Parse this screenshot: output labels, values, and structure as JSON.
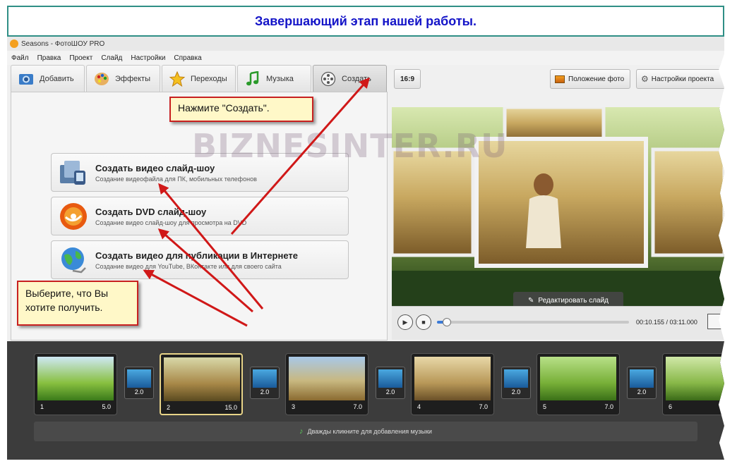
{
  "banner": {
    "text": "Завершающий этап нашей работы."
  },
  "app": {
    "title": "Seasons - ФотоШОУ PRO"
  },
  "menu": [
    "Файл",
    "Правка",
    "Проект",
    "Слайд",
    "Настройки",
    "Справка"
  ],
  "tabs": [
    {
      "label": "Добавить",
      "icon": "add-photo-icon"
    },
    {
      "label": "Эффекты",
      "icon": "palette-icon"
    },
    {
      "label": "Переходы",
      "icon": "star-icon"
    },
    {
      "label": "Музыка",
      "icon": "music-note-icon"
    },
    {
      "label": "Создать",
      "icon": "film-reel-icon"
    }
  ],
  "options": [
    {
      "title": "Создать видео слайд-шоу",
      "subtitle": "Создание видеофайла для ПК, мобильных телефонов",
      "icon": "video-file-icon"
    },
    {
      "title": "Создать DVD слайд-шоу",
      "subtitle": "Создание видео слайд-шоу для просмотра на DVD",
      "icon": "dvd-icon"
    },
    {
      "title": "Создать видео для публикации в Интернете",
      "subtitle": "Создание видео для YouTube, ВКонтакте или для своего сайта",
      "icon": "globe-icon"
    }
  ],
  "toolbar": {
    "ratio": "16:9",
    "photo_position": "Положение фото",
    "project_settings": "Настройки проекта"
  },
  "preview": {
    "edit_slide": "Редактировать слайд"
  },
  "player": {
    "time": "00:10.155 / 03:11.000",
    "progress": 0.05
  },
  "callouts": {
    "create": "Нажмите \"Создать\".",
    "choose": "Выберите, что Вы хотите получить."
  },
  "watermark": "BIZNESINTER.RU",
  "slides": [
    {
      "num": "1",
      "dur": "5.0"
    },
    {
      "num": "2",
      "dur": "15.0"
    },
    {
      "num": "3",
      "dur": "7.0"
    },
    {
      "num": "4",
      "dur": "7.0"
    },
    {
      "num": "5",
      "dur": "7.0"
    },
    {
      "num": "6",
      "dur": ""
    }
  ],
  "transitions": [
    "2.0",
    "2.0",
    "2.0",
    "2.0",
    "2.0"
  ],
  "music_hint": "Дважды кликните для добавления музыки",
  "colors": {
    "banner_text": "#1414c8",
    "banner_border": "#2f8f86",
    "arrow": "#d01818",
    "callout_bg": "#fff8c8"
  }
}
